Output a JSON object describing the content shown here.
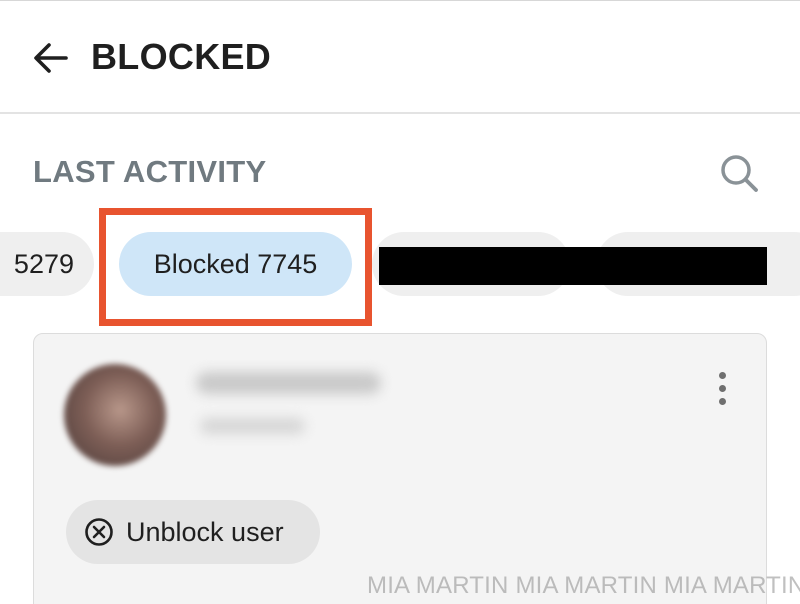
{
  "header": {
    "title": "BLOCKED",
    "back_icon": "arrow-left-icon"
  },
  "section": {
    "title": "LAST ACTIVITY",
    "search_icon": "search-icon"
  },
  "filters": {
    "previous_chip_label": "5279",
    "blocked_chip_label": "Blocked 7745",
    "highlight_color": "#e8542f",
    "active_chip_color": "#cfe6f8"
  },
  "card": {
    "more_icon": "more-vertical-icon",
    "unblock_label": "Unblock user",
    "unblock_icon": "circle-x-icon"
  },
  "watermark": {
    "text": "MIA MARTIN MIA MARTIN MIA MARTIN"
  }
}
